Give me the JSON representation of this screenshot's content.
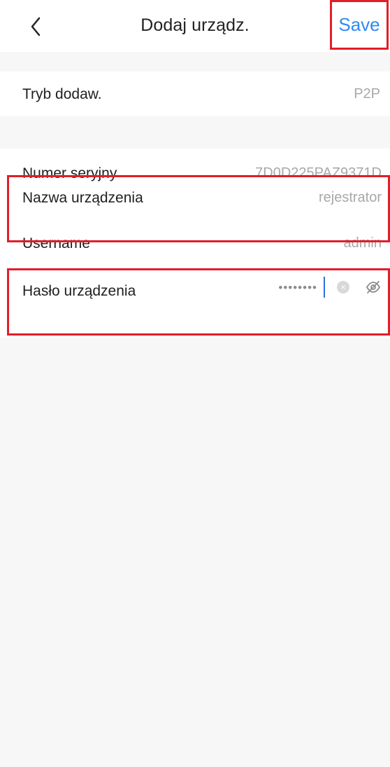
{
  "header": {
    "title": "Dodaj urządz.",
    "save_label": "Save"
  },
  "add_mode": {
    "label": "Tryb dodaw.",
    "value": "P2P"
  },
  "device": {
    "serial_label": "Numer seryjny",
    "serial_value": "7D0D225PAZ9371D",
    "name_label": "Nazwa urządzenia",
    "name_value": "rejestrator",
    "username_label": "Username",
    "username_value": "admin",
    "password_label": "Hasło urządzenia",
    "password_value": "••••••••"
  },
  "colors": {
    "accent": "#2f89f4",
    "highlight": "#e11d2a",
    "background": "#f7f7f7"
  },
  "icons": {
    "back": "chevron-left-icon",
    "clear": "clear-icon",
    "visibility": "eye-off-icon"
  }
}
